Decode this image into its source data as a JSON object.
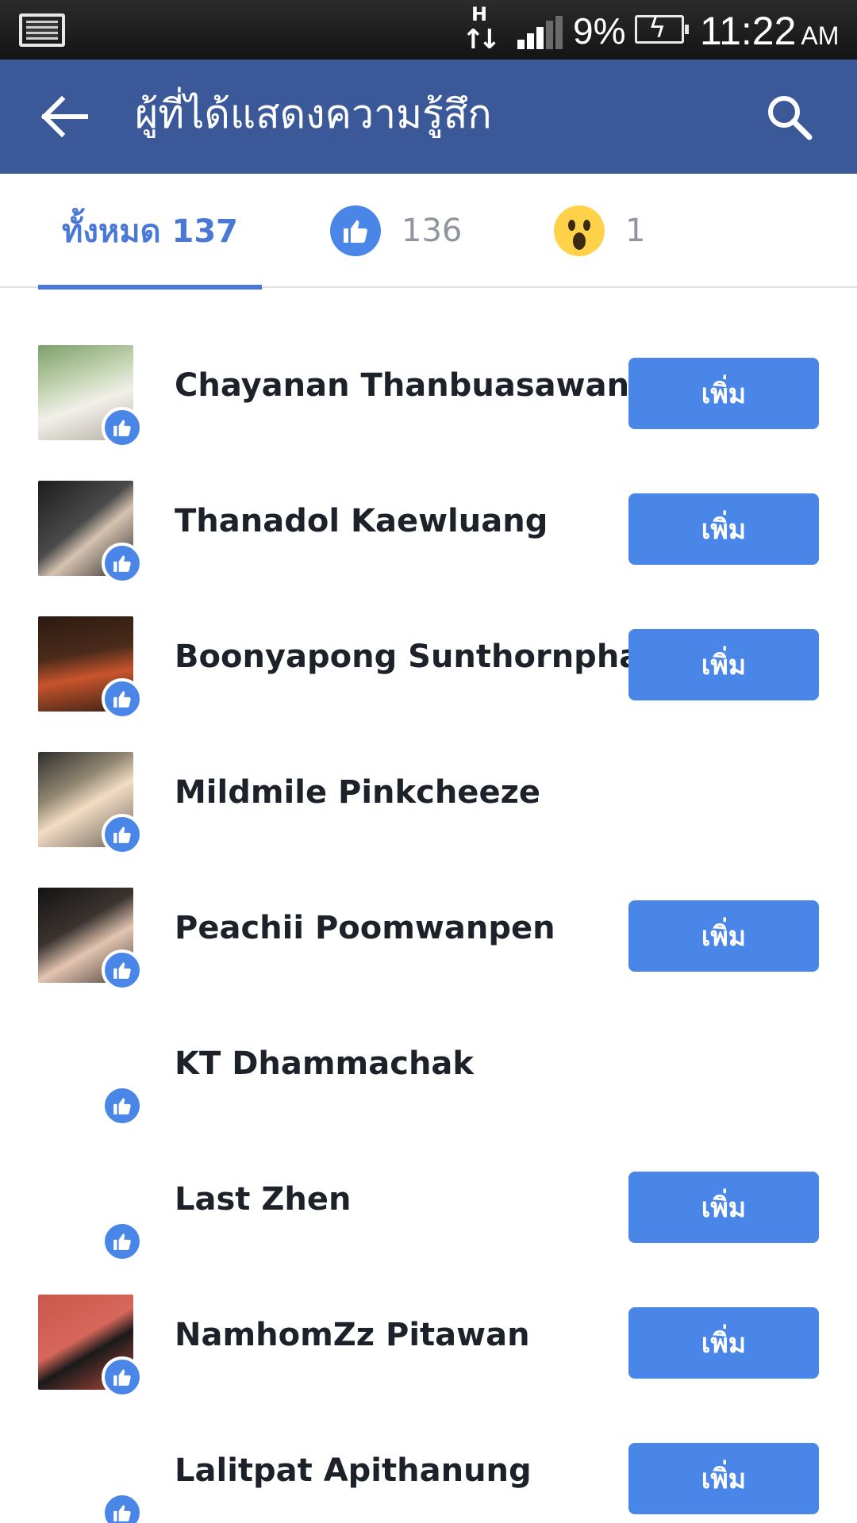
{
  "status_bar": {
    "network_type": "H",
    "battery_percent": "9%",
    "time": "11:22",
    "ampm": "AM"
  },
  "header": {
    "title": "ผู้ที่ได้แสดงความรู้สึก",
    "back_icon": "back-arrow-icon",
    "search_icon": "search-icon"
  },
  "tabs": {
    "all": {
      "label": "ทั้งหมด 137"
    },
    "like": {
      "icon": "like-icon",
      "count": "136"
    },
    "wow": {
      "icon": "wow-icon",
      "count": "1"
    }
  },
  "people": [
    {
      "name": "Chayanan Thanbuasawan",
      "add_label": "เพิ่ม"
    },
    {
      "name": "Thanadol Kaewluang",
      "add_label": "เพิ่ม"
    },
    {
      "name": "Boonyapong Sunthornphan",
      "add_label": "เพิ่ม"
    },
    {
      "name": "Mildmile Pinkcheeze"
    },
    {
      "name": "Peachii Poomwanpen",
      "add_label": "เพิ่ม"
    },
    {
      "name": "KT Dhammachak"
    },
    {
      "name": "Last Zhen",
      "add_label": "เพิ่ม"
    },
    {
      "name": "NamhomZz Pitawan",
      "add_label": "เพิ่ม"
    },
    {
      "name": "Lalitpat Apithanung",
      "add_label": "เพิ่ม"
    }
  ],
  "colors": {
    "header": "#3b5998",
    "accent": "#4a86e8",
    "text": "#1d2129"
  }
}
